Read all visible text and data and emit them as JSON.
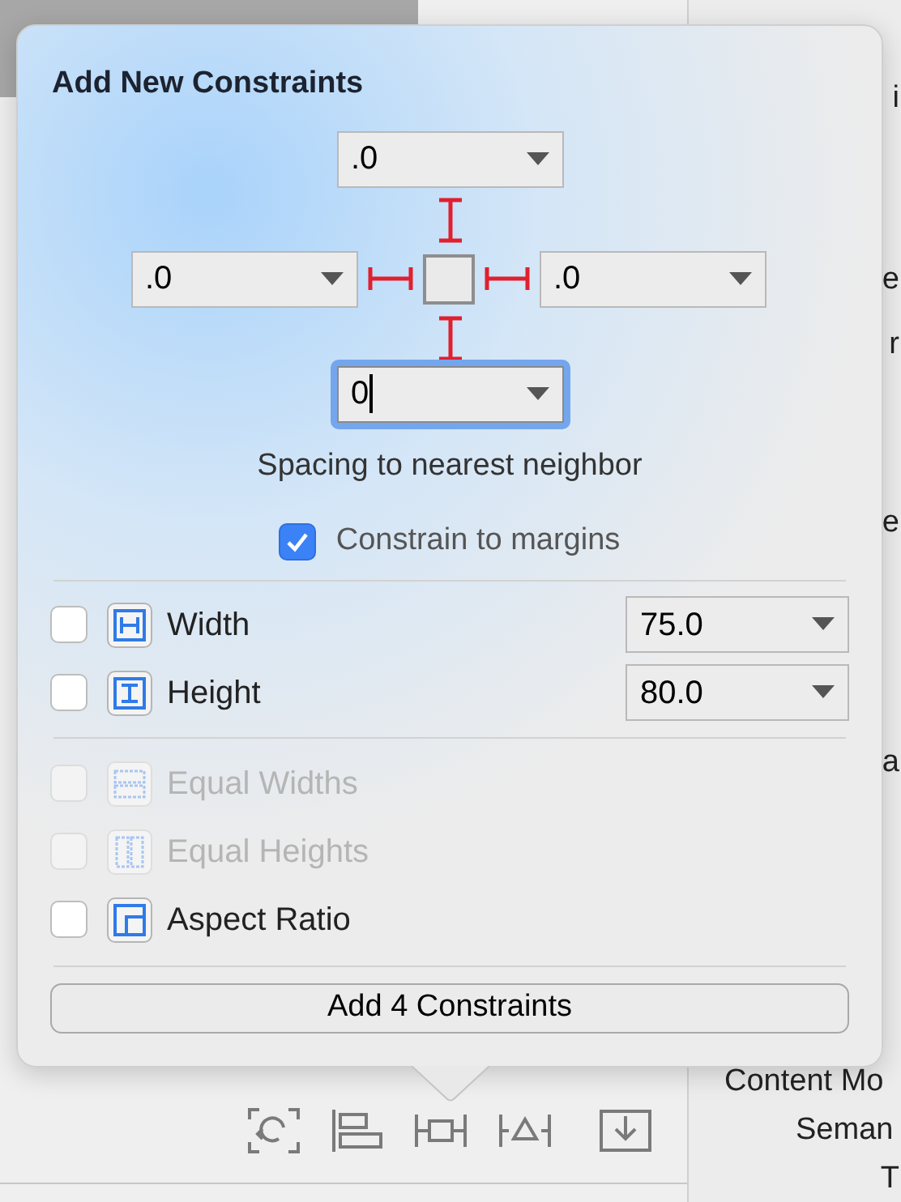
{
  "inspector": {
    "labels": [
      {
        "text": "i",
        "kind": "edge"
      },
      {
        "text": "e",
        "kind": "edge"
      },
      {
        "text": "r",
        "kind": "edge"
      },
      {
        "text": "e",
        "kind": "edge"
      },
      {
        "text": "a",
        "kind": "edge"
      },
      {
        "text": "Content Mo",
        "kind": "wide"
      },
      {
        "text": "Seman",
        "kind": "mid"
      },
      {
        "text": "T",
        "kind": "edge"
      }
    ]
  },
  "popover": {
    "title": "Add New Constraints",
    "spacing": {
      "top": {
        "value": ".0",
        "focused": false
      },
      "left": {
        "value": ".0",
        "focused": false
      },
      "right": {
        "value": ".0",
        "focused": false
      },
      "bottom": {
        "value": "0",
        "focused": true
      }
    },
    "spacing_caption": "Spacing to nearest neighbor",
    "constrain_to_margins": {
      "label": "Constrain to margins",
      "checked": true
    },
    "size_rows": [
      {
        "kind": "width",
        "label": "Width",
        "checked": false,
        "disabled": false,
        "value": "75.0"
      },
      {
        "kind": "height",
        "label": "Height",
        "checked": false,
        "disabled": false,
        "value": "80.0"
      }
    ],
    "equality_rows": [
      {
        "kind": "equal-widths",
        "label": "Equal Widths",
        "checked": false,
        "disabled": true
      },
      {
        "kind": "equal-heights",
        "label": "Equal Heights",
        "checked": false,
        "disabled": true
      },
      {
        "kind": "aspect-ratio",
        "label": "Aspect Ratio",
        "checked": false,
        "disabled": false
      }
    ],
    "add_button": "Add 4 Constraints"
  }
}
